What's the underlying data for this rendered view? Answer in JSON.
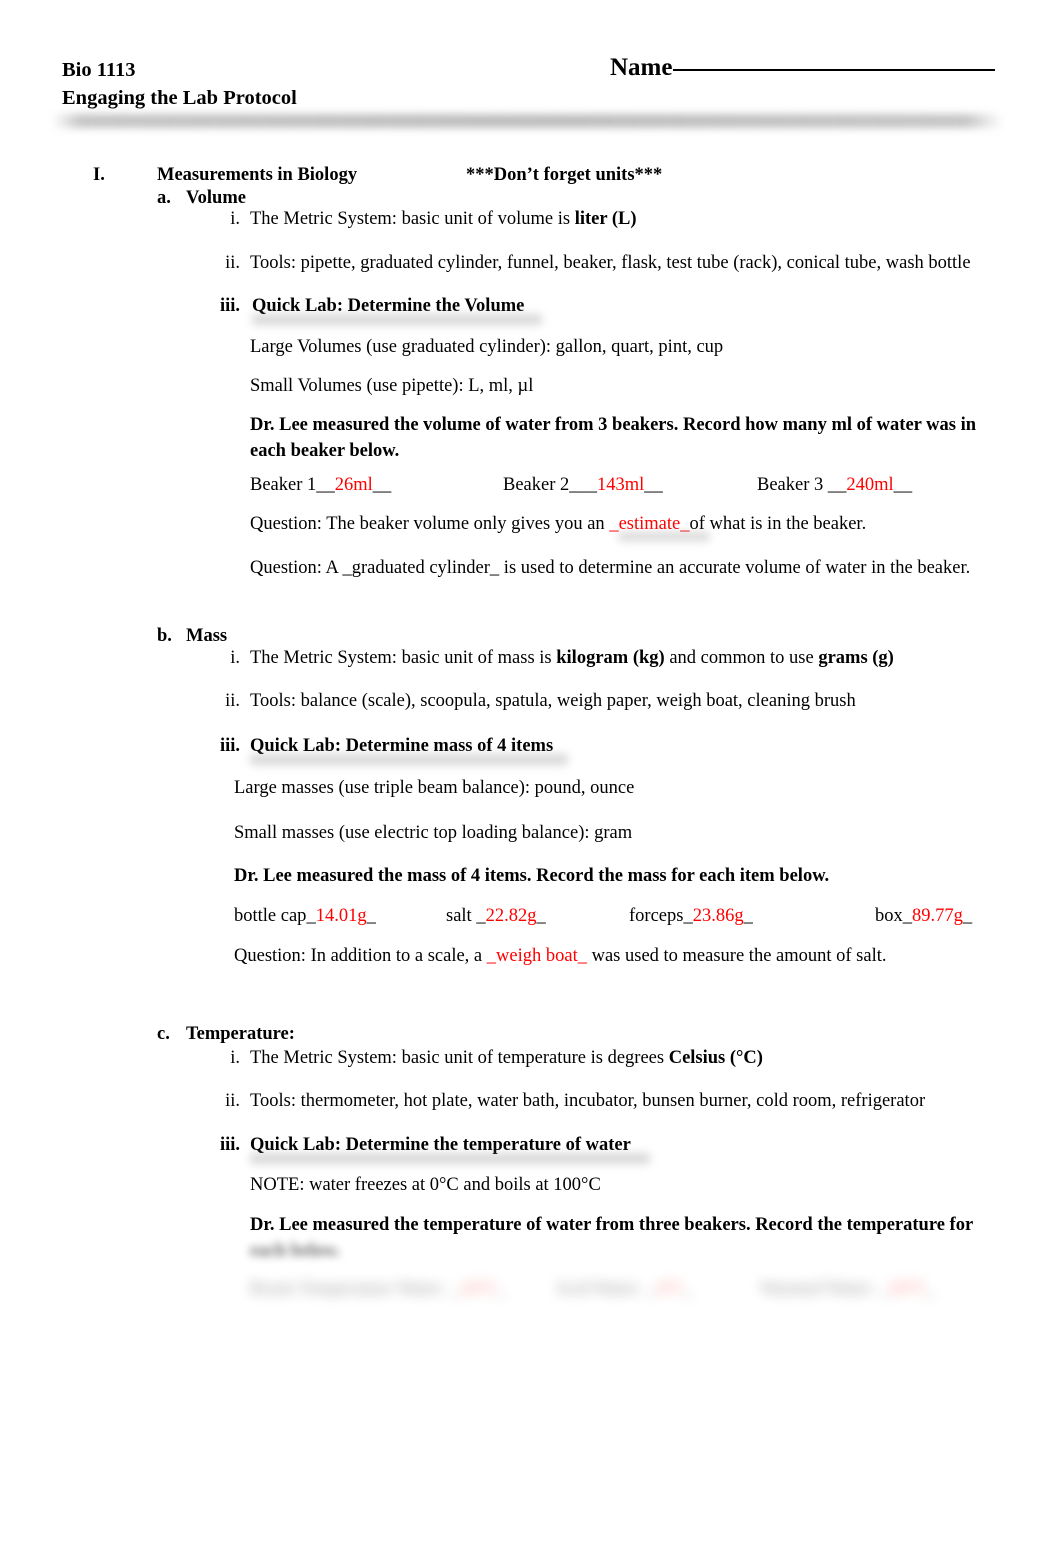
{
  "document": {
    "course_code": "Bio 1113",
    "doc_title": "Engaging the Lab Protocol",
    "name_label": "Name",
    "redacted_header_line": ""
  },
  "section": {
    "numeral": "I.",
    "title": "Measurements in Biology",
    "note": "***Don’t forget units***"
  },
  "volume": {
    "marker": "a.",
    "heading": "Volume",
    "items": [
      {
        "marker": "i.",
        "text_pre": "The Metric System: basic unit of volume is ",
        "text_bold": "liter (L)"
      },
      {
        "marker": "ii.",
        "text": "Tools: pipette, graduated cylinder, funnel, beaker, flask, test tube (rack), conical tube, wash bottle"
      },
      {
        "marker": "iii.",
        "text": "Quick Lab: Determine the Volume"
      }
    ],
    "large_volumes": "Large Volumes (use graduated cylinder): gallon, quart, pint, cup",
    "small_volumes": "Small Volumes (use pipette): L, ml, µl",
    "prompt": "Dr. Lee measured the volume of water from 3 beakers. Record how many ml of water was in each beaker below.",
    "beakers": [
      {
        "label": "Beaker 1",
        "lead": "__",
        "value": "26ml",
        "trail": "__"
      },
      {
        "label": "Beaker 2",
        "lead": "___",
        "value": "143ml",
        "trail": "__"
      },
      {
        "label": "Beaker 3",
        "lead": " __",
        "value": "240ml",
        "trail": "__"
      }
    ],
    "question1_pre": "Question: The beaker volume only gives you an ",
    "question1_answer": "_estimate_",
    "question1_post": "of what is in the beaker.",
    "question2": "Question: A _graduated cylinder_ is used to determine an accurate volume of water in the beaker."
  },
  "mass": {
    "marker": "b.",
    "heading": "Mass",
    "items": [
      {
        "marker": "i.",
        "text_pre": "The Metric System: basic unit of mass is ",
        "text_bold": "kilogram (kg)",
        "text_mid": " and common to use ",
        "text_bold2": "grams (g)"
      },
      {
        "marker": "ii.",
        "text": "Tools: balance (scale), scoopula, spatula, weigh paper, weigh boat, cleaning brush"
      },
      {
        "marker": "iii.",
        "text": "Quick Lab: Determine mass of 4 items"
      }
    ],
    "large_masses": "Large masses (use triple beam balance): pound, ounce",
    "small_masses": "Small masses (use electric top loading balance): gram",
    "prompt": "Dr. Lee measured the mass of 4 items. Record the mass for each item below.",
    "entries": [
      {
        "label": "bottle cap",
        "lead": "_",
        "value": "14.01g",
        "trail": "_"
      },
      {
        "label": "salt ",
        "lead": "_",
        "value": "22.82g",
        "trail": "_"
      },
      {
        "label": "forceps",
        "lead": "_",
        "value": "23.86g",
        "trail": "_"
      },
      {
        "label": "box",
        "lead": "_",
        "value": "89.77g",
        "trail": "_"
      }
    ],
    "question_pre": "Question: In addition to a scale, a ",
    "question_answer": "_weigh boat_",
    "question_post": " was used to measure the amount of salt."
  },
  "temperature": {
    "marker": "c.",
    "heading": "Temperature:",
    "items": [
      {
        "marker": "i.",
        "text_pre": "The Metric System: basic unit of temperature is degrees ",
        "text_bold": "Celsius (°C)"
      },
      {
        "marker": "ii.",
        "text": "Tools: thermometer, hot plate, water bath, incubator, bunsen burner, cold room, refrigerator"
      },
      {
        "marker": "iii.",
        "text": "Quick Lab: Determine the temperature of water"
      }
    ],
    "note": "NOTE: water freezes at 0°C and boils at 100°C",
    "prompt_line1": "Dr. Lee measured the temperature of water from three beakers. Record the temperature for",
    "prompt_line2": "each below.",
    "entries": [
      {
        "label": "Room Temperature Water: ",
        "lead": "_",
        "value": "24°C",
        "trail": "_"
      },
      {
        "label": "Iced Water: ",
        "lead": "_",
        "value": "4°C",
        "trail": "_"
      },
      {
        "label": "Warmed Water: ",
        "lead": "_",
        "value": "50°C",
        "trail": "_"
      }
    ]
  },
  "colors": {
    "answer_red": "#FF0000",
    "text_black": "#000000",
    "page_background": "#FFFFFF"
  }
}
